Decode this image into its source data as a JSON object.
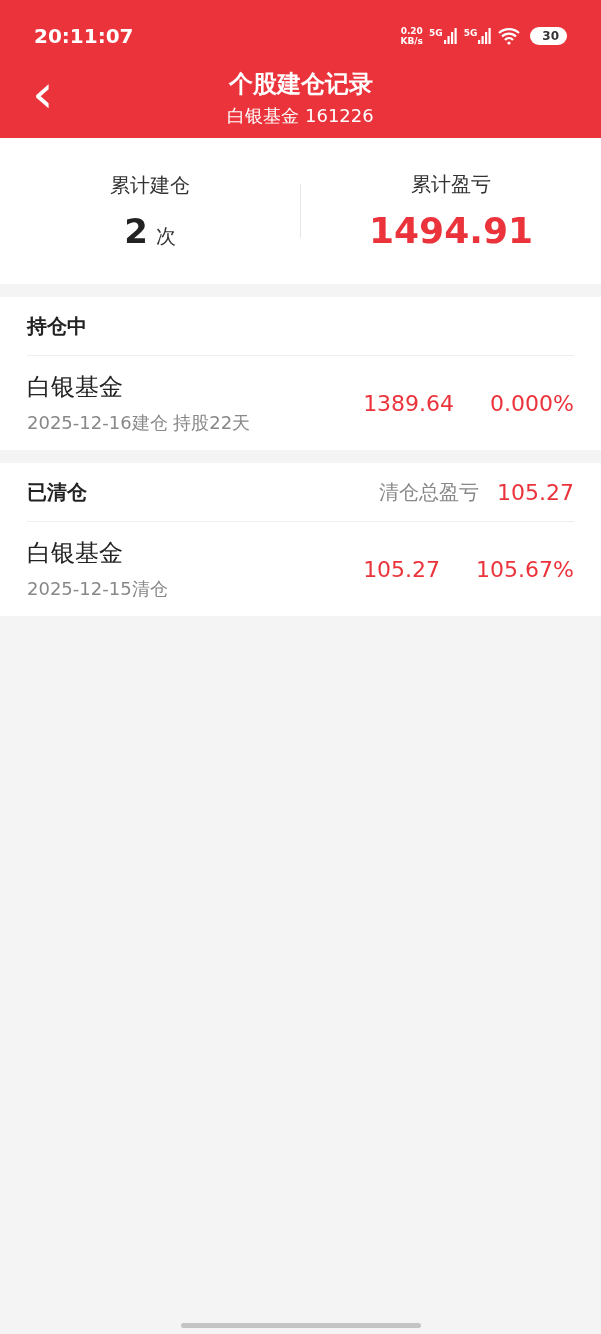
{
  "status_bar": {
    "time": "20:11:07",
    "speed": [
      "0.20",
      "KB/s"
    ],
    "networks": [
      "5G",
      "5G"
    ],
    "battery": "30"
  },
  "header": {
    "back": "‹",
    "title": "个股建仓记录",
    "subtitle": "白银基金 161226"
  },
  "summary": [
    {
      "kind": "count",
      "label": "累计建仓",
      "value": "2",
      "unit": "次"
    },
    {
      "kind": "money",
      "label": "累计盈亏",
      "value": "1494.91"
    }
  ],
  "sections": [
    {
      "title": "持仓中",
      "items": [
        {
          "name": "白银基金",
          "date": "2025-12-16建仓 持股22天",
          "amount": "1389.64",
          "percent": "0.000%"
        }
      ]
    },
    {
      "title": "已清仓",
      "summary_label": "清仓总盈亏",
      "summary_value": "105.27",
      "items": [
        {
          "name": "白银基金",
          "date": "2025-12-15清仓",
          "amount": "105.27",
          "percent": "105.67%"
        }
      ]
    }
  ]
}
